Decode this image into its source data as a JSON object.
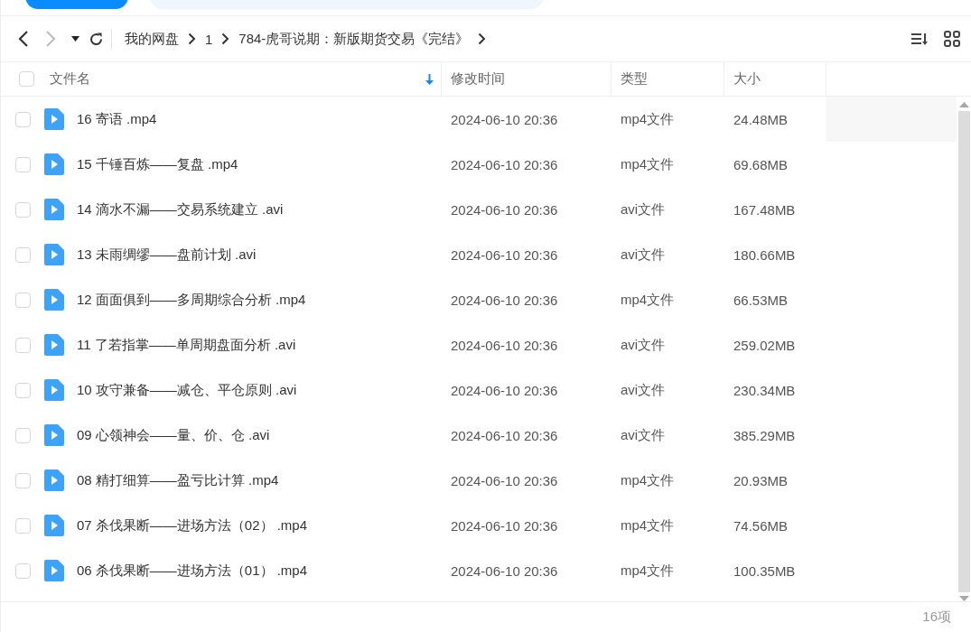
{
  "breadcrumb": [
    "我的网盘",
    "1",
    "784-虎哥说期：新版期货交易《完结》"
  ],
  "table": {
    "select_all": {
      "checked": false
    },
    "columns": [
      {
        "label": "文件名",
        "sorted": true
      },
      {
        "label": "修改时间",
        "sorted": false
      },
      {
        "label": "类型",
        "sorted": false
      },
      {
        "label": "大小",
        "sorted": false
      }
    ],
    "rows": [
      {
        "name": "16 寄语 .mp4",
        "modified": "2024-06-10 20:36",
        "type": "mp4文件",
        "size": "24.48MB",
        "checked": false,
        "hovered": true
      },
      {
        "name": "15 千锤百炼——复盘 .mp4",
        "modified": "2024-06-10 20:36",
        "type": "mp4文件",
        "size": "69.68MB",
        "checked": false,
        "hovered": false
      },
      {
        "name": "14 滴水不漏——交易系统建立 .avi",
        "modified": "2024-06-10 20:36",
        "type": "avi文件",
        "size": "167.48MB",
        "checked": false,
        "hovered": false
      },
      {
        "name": "13 未雨绸缪——盘前计划 .avi",
        "modified": "2024-06-10 20:36",
        "type": "avi文件",
        "size": "180.66MB",
        "checked": false,
        "hovered": false
      },
      {
        "name": "12 面面俱到——多周期综合分析 .mp4",
        "modified": "2024-06-10 20:36",
        "type": "mp4文件",
        "size": "66.53MB",
        "checked": false,
        "hovered": false
      },
      {
        "name": "11 了若指掌——单周期盘面分析 .avi",
        "modified": "2024-06-10 20:36",
        "type": "avi文件",
        "size": "259.02MB",
        "checked": false,
        "hovered": false
      },
      {
        "name": "10 攻守兼备——减仓、平仓原则 .avi",
        "modified": "2024-06-10 20:36",
        "type": "avi文件",
        "size": "230.34MB",
        "checked": false,
        "hovered": false
      },
      {
        "name": "09 心领神会——量、价、仓 .avi",
        "modified": "2024-06-10 20:36",
        "type": "avi文件",
        "size": "385.29MB",
        "checked": false,
        "hovered": false
      },
      {
        "name": "08 精打细算——盈亏比计算 .mp4",
        "modified": "2024-06-10 20:36",
        "type": "mp4文件",
        "size": "20.93MB",
        "checked": false,
        "hovered": false
      },
      {
        "name": "07 杀伐果断——进场方法（02） .mp4",
        "modified": "2024-06-10 20:36",
        "type": "mp4文件",
        "size": "74.56MB",
        "checked": false,
        "hovered": false
      },
      {
        "name": "06 杀伐果断——进场方法（01） .mp4",
        "modified": "2024-06-10 20:36",
        "type": "mp4文件",
        "size": "100.35MB",
        "checked": false,
        "hovered": false
      }
    ]
  },
  "status_bar": {
    "count": "16项"
  }
}
